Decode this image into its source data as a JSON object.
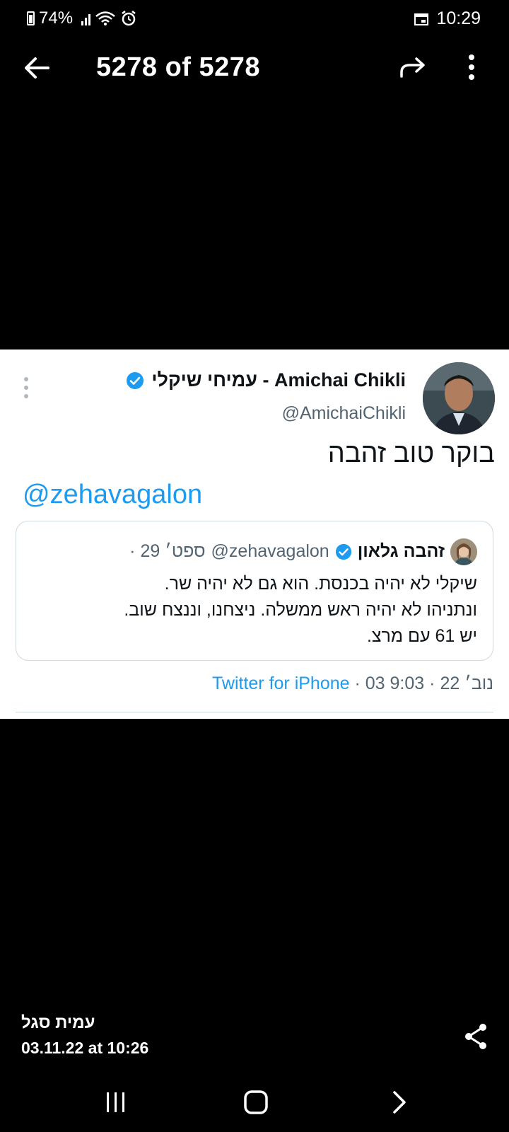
{
  "status_bar": {
    "battery": "74%",
    "time": "10:29"
  },
  "viewer": {
    "counter": "5278 of 5278"
  },
  "tweet": {
    "author_name": "עמיחי שיקלי - Amichai Chikli",
    "handle": "@AmichaiChikli",
    "text": "בוקר טוב זהבה",
    "mention": "@zehavagalon",
    "quote": {
      "name": "זהבה גלאון",
      "handle": "@zehavagalon",
      "date": "· 29 ספט׳",
      "lines": [
        "שיקלי לא יהיה בכנסת. הוא גם לא יהיה שר.",
        "ונתניהו לא יהיה ראש ממשלה. ניצחנו, וננצח שוב.",
        "יש 61 עם מרצ."
      ]
    },
    "footer": {
      "time": "9:03",
      "date": "· 03 נוב׳ 22 ·",
      "source": "Twitter for iPhone"
    }
  },
  "message": {
    "sender": "עמית סגל",
    "timestamp": "03.11.22 at 10:26"
  },
  "colors": {
    "link": "#1d9bf0",
    "verified": "#1d9bf0",
    "secondary_text": "#536471"
  }
}
